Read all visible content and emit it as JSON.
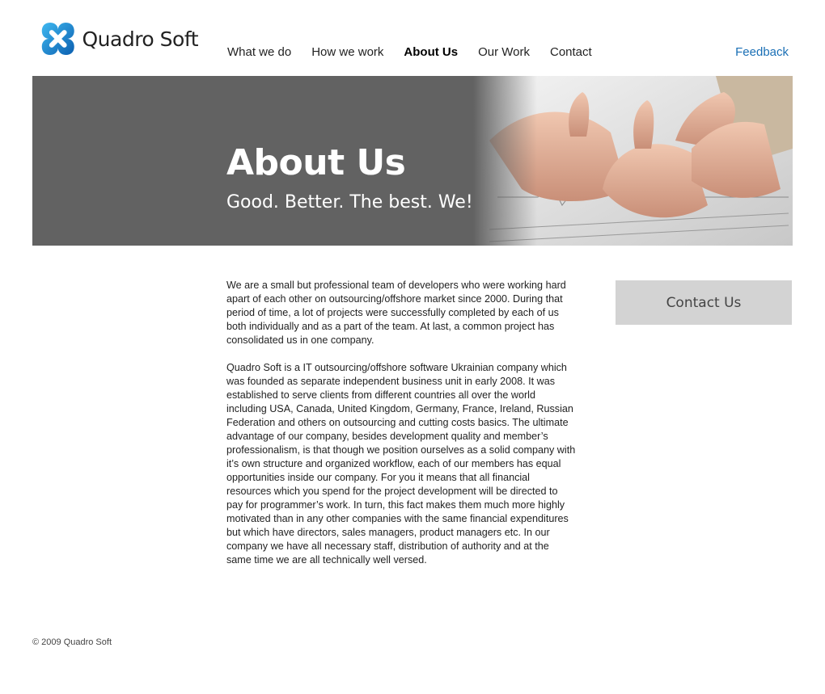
{
  "brand": {
    "name": "Quadro Soft",
    "logo_icon": "quadro-logo-icon",
    "accent_color": "#1a6fb5"
  },
  "nav": {
    "items": [
      {
        "label": "What we do",
        "active": false
      },
      {
        "label": "How we work",
        "active": false
      },
      {
        "label": "About Us",
        "active": true
      },
      {
        "label": "Our Work",
        "active": false
      },
      {
        "label": "Contact",
        "active": false
      }
    ],
    "feedback": "Feedback"
  },
  "hero": {
    "title": "About Us",
    "subtitle": "Good. Better. The best. We!",
    "background_color": "#626262",
    "image": "thumbs-up-hands-photo"
  },
  "content": {
    "paragraphs": [
      "We are a small but professional team of developers who were working hard apart of each other on outsourcing/offshore market since 2000. During that period of time, a lot of projects were successfully completed by each of us both individually and as a part of the team. At last, a common project has consolidated us in one company.",
      "Quadro Soft is a IT outsourcing/offshore software Ukrainian company which was founded as separate independent business unit in early 2008. It was established to serve clients from different countries all over the world including USA, Canada, United Kingdom, Germany, France, Ireland, Russian Federation and others on outsourcing and cutting costs basics. The ultimate advantage of our company, besides development quality and member’s professionalism, is that though we position ourselves as a solid company with it’s own structure and organized workflow,  each of our members has equal opportunities inside our company. For you it means that all financial resources which you spend for the project development will be directed to pay for programmer’s work. In turn, this fact makes them much more highly motivated than in any other companies with the same financial expenditures but which have directors, sales managers, product managers etc. In our company we have all necessary staff, distribution of authority and at the same time we are all technically well versed."
    ]
  },
  "sidebar": {
    "contact_button": "Contact Us"
  },
  "footer": {
    "copyright": "© 2009 Quadro Soft"
  }
}
